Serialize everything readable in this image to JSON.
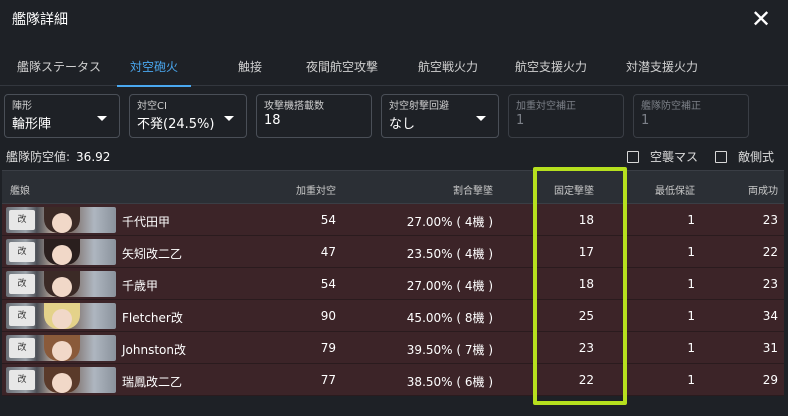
{
  "window": {
    "title": "艦隊詳細"
  },
  "tabs": [
    {
      "label": "艦隊ステータス",
      "active": false
    },
    {
      "label": "対空砲火",
      "active": true
    },
    {
      "label": "触接",
      "active": false
    },
    {
      "label": "夜間航空攻撃",
      "active": false
    },
    {
      "label": "航空戦火力",
      "active": false
    },
    {
      "label": "航空支援火力",
      "active": false
    },
    {
      "label": "対潜支援火力",
      "active": false
    }
  ],
  "fields": [
    {
      "label": "陣形",
      "value": "輪形陣",
      "dropdown": true,
      "disabled": false
    },
    {
      "label": "対空CI",
      "value": "不発(24.5%)",
      "dropdown": true,
      "disabled": false
    },
    {
      "label": "攻撃機搭載数",
      "value": "18",
      "dropdown": false,
      "disabled": false
    },
    {
      "label": "対空射撃回避",
      "value": "なし",
      "dropdown": true,
      "disabled": false
    },
    {
      "label": "加重対空補正",
      "value": "1",
      "dropdown": false,
      "disabled": true
    },
    {
      "label": "艦隊防空補正",
      "value": "1",
      "dropdown": false,
      "disabled": true
    }
  ],
  "fleet_aa": {
    "label": "艦隊防空値:",
    "value": "36.92"
  },
  "checkboxes": [
    {
      "label": "空襲マス",
      "checked": false
    },
    {
      "label": "敵側式",
      "checked": false
    }
  ],
  "table": {
    "headers": [
      "艦娘",
      "加重対空",
      "割合撃墜",
      "固定撃墜",
      "最低保証",
      "両成功"
    ],
    "rows": [
      {
        "name": "千代田甲",
        "weighted_aa": "54",
        "proportional": "27.00% ( 4機 )",
        "fixed": "18",
        "minimum": "1",
        "both": "23",
        "hair": "#3b2a26"
      },
      {
        "name": "矢矧改二乙",
        "weighted_aa": "47",
        "proportional": "23.50% ( 4機 )",
        "fixed": "17",
        "minimum": "1",
        "both": "22",
        "hair": "#2a1f1e"
      },
      {
        "name": "千歳甲",
        "weighted_aa": "54",
        "proportional": "27.00% ( 4機 )",
        "fixed": "18",
        "minimum": "1",
        "both": "23",
        "hair": "#3b2a26"
      },
      {
        "name": "Fletcher改",
        "weighted_aa": "90",
        "proportional": "45.00% ( 8機 )",
        "fixed": "25",
        "minimum": "1",
        "both": "34",
        "hair": "#e4d28a"
      },
      {
        "name": "Johnston改",
        "weighted_aa": "79",
        "proportional": "39.50% ( 7機 )",
        "fixed": "23",
        "minimum": "1",
        "both": "31",
        "hair": "#8a5a3a"
      },
      {
        "name": "瑞鳳改二乙",
        "weighted_aa": "77",
        "proportional": "38.50% ( 6機 )",
        "fixed": "22",
        "minimum": "1",
        "both": "29",
        "hair": "#5a3a2a"
      }
    ]
  },
  "icons": {
    "close": "close-icon",
    "dropdown": "chevron-down-icon",
    "checkbox": "checkbox-icon"
  },
  "colors": {
    "accent": "#4aa8f0",
    "row_bg": "#3c2428",
    "highlight": "#b6e01e"
  }
}
